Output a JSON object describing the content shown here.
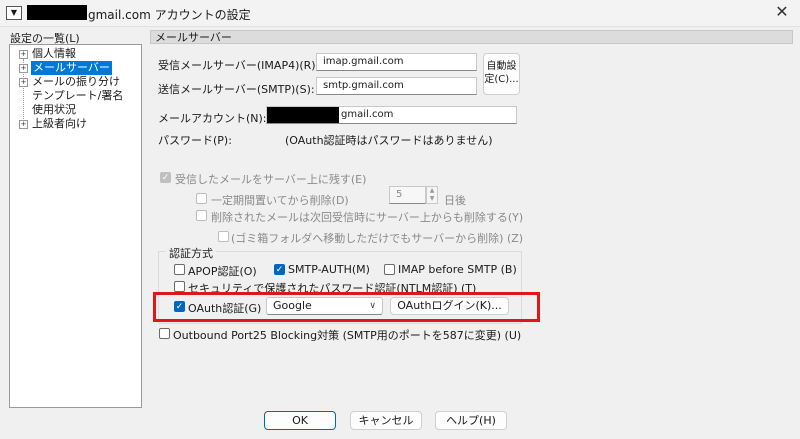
{
  "window": {
    "title": "gmail.com アカウントの設定",
    "close_glyph": "✕",
    "menu_glyph": "▼"
  },
  "tree": {
    "header": "設定の一覧(L)",
    "items": [
      {
        "label": "個人情報",
        "expand": "+"
      },
      {
        "label": "メールサーバー",
        "expand": "+"
      },
      {
        "label": "メールの振り分け",
        "expand": "+"
      },
      {
        "label": "テンプレート/署名",
        "expand": ""
      },
      {
        "label": "使用状況",
        "expand": ""
      },
      {
        "label": "上級者向け",
        "expand": "+"
      }
    ]
  },
  "panel": {
    "section_title": "メールサーバー",
    "imap_label": "受信メールサーバー(IMAP4)(R):",
    "imap_value": "imap.gmail.com",
    "smtp_label": "送信メールサーバー(SMTP)(S):",
    "smtp_value": "smtp.gmail.com",
    "auto_button": "自動設定(C)...",
    "account_label": "メールアカウント(N):",
    "account_value": "gmail.com",
    "password_label": "パスワード(P):",
    "password_note": "(OAuth認証時はパスワードはありません)",
    "leave_on_server": "受信したメールをサーバー上に残す(E)",
    "delete_after": "一定期間置いてから削除(D)",
    "days_value": "5",
    "days_unit": "日後",
    "delete_deleted": "削除されたメールは次回受信時にサーバー上からも削除する(Y)",
    "trash_note": "(ゴミ箱フォルダへ移動しただけでもサーバーから削除) (Z)",
    "auth_group_title": "認証方式",
    "apop": "APOP認証(O)",
    "smtp_auth": "SMTP-AUTH(M)",
    "imap_before_smtp": "IMAP before SMTP (B)",
    "ntlm": "セキュリティで保護されたパスワード認証(NTLM認証) (T)",
    "oauth": "OAuth認証(G)",
    "oauth_provider": "Google",
    "oauth_login_button": "OAuthログイン(K)...",
    "outbound25": "Outbound Port25 Blocking対策 (SMTP用のポートを587に変更) (U)"
  },
  "footer": {
    "ok": "OK",
    "cancel": "キャンセル",
    "help": "ヘルプ(H)"
  },
  "checkmark": "✓",
  "colors": {
    "accent": "#0067c0",
    "selection": "#0078d7",
    "highlight_border": "#e0161d"
  }
}
